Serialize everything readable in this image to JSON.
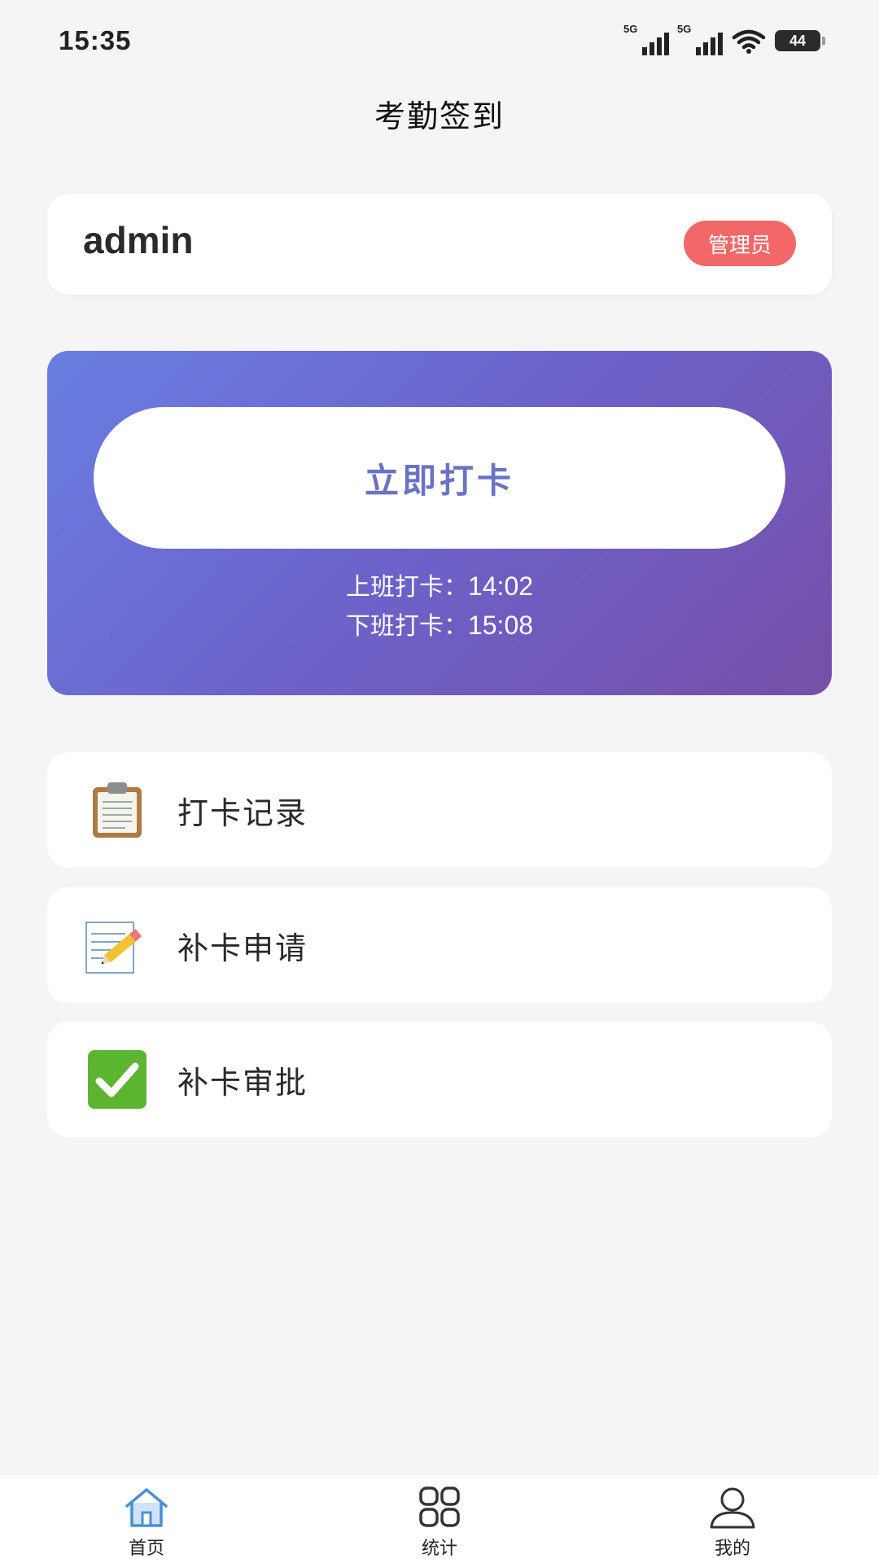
{
  "status_bar": {
    "time": "15:35",
    "signal1_gen": "5G",
    "signal2_gen": "5G",
    "battery": "44"
  },
  "header": {
    "title": "考勤签到"
  },
  "user": {
    "name": "admin",
    "role_badge": "管理员"
  },
  "punch": {
    "button_label": "立即打卡",
    "checkin_label": "上班打卡：",
    "checkin_time": "14:02",
    "checkout_label": "下班打卡：",
    "checkout_time": "15:08"
  },
  "menu": [
    {
      "label": "打卡记录",
      "icon": "clipboard-icon"
    },
    {
      "label": "补卡申请",
      "icon": "memo-pencil-icon"
    },
    {
      "label": "补卡审批",
      "icon": "check-mark-icon"
    }
  ],
  "tabs": [
    {
      "label": "首页",
      "icon": "home-icon",
      "active": true
    },
    {
      "label": "统计",
      "icon": "grid-icon",
      "active": false
    },
    {
      "label": "我的",
      "icon": "user-icon",
      "active": false
    }
  ],
  "colors": {
    "accent": "#6a72c4",
    "badge": "#f26868",
    "tab_active": "#4a8fd6"
  }
}
